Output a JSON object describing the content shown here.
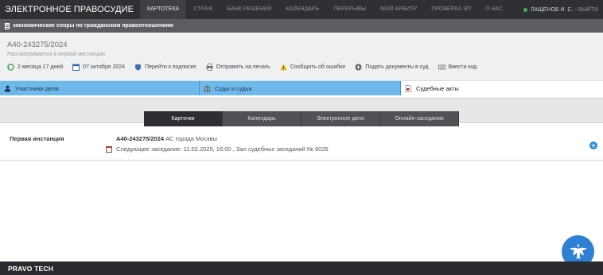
{
  "header": {
    "brand": "ЭЛЕКТРОННОЕ ПРАВОСУДИЕ",
    "nav": [
      {
        "label": "КАРТОТЕКА",
        "active": true
      },
      {
        "label": "СТРАЖ",
        "active": false
      },
      {
        "label": "БАНК РЕШЕНИЙ",
        "active": false
      },
      {
        "label": "КАЛЕНДАРЬ",
        "active": false
      },
      {
        "label": "ПЕРЕРЫВЫ",
        "active": false
      },
      {
        "label": "МОЙ АРБИТР",
        "active": false
      },
      {
        "label": "ПРОВЕРКА ЭП",
        "active": false
      },
      {
        "label": "О НАС",
        "active": false
      }
    ],
    "user_name": "ЛАЩЕНОВ И. С.",
    "separator": "-",
    "logout_label": "ВЫЙТИ",
    "online_color": "#46b446"
  },
  "category": {
    "label": "экономические споры по гражданским правоотношениям"
  },
  "case": {
    "number": "А40-243275/2024",
    "status": "Рассматривается в первой инстанции",
    "duration": "2 месяца 17 дней",
    "date": "07 октября 2024",
    "actions": {
      "subscribe": "Перейти к подписке",
      "print": "Отправить на печать",
      "report_error": "Сообщить об ошибке",
      "submit_docs": "Подать документы в суд",
      "enter_code": "Ввести код"
    }
  },
  "tabs": {
    "participants": "Участники дела",
    "courts": "Суды и судьи",
    "acts": "Судебные акты"
  },
  "subtabs": {
    "cards": "Карточки",
    "calendar": "Календарь",
    "e_case": "Электронное дело",
    "online": "Онлайн-заседания"
  },
  "instance": {
    "label": "Первая инстанция",
    "case_number": "А40-243275/2024",
    "court": "АС города Москвы",
    "next_hearing": "Следующее заседание: 11.02.2025, 16:00 , Зал судебных заседаний № 6026"
  },
  "footer": {
    "logo": "PRAVO TECH"
  },
  "colors": {
    "accent_blue": "#6eb9ec",
    "topbar": "#2f3033",
    "plus_blue": "#2f8dd6"
  }
}
